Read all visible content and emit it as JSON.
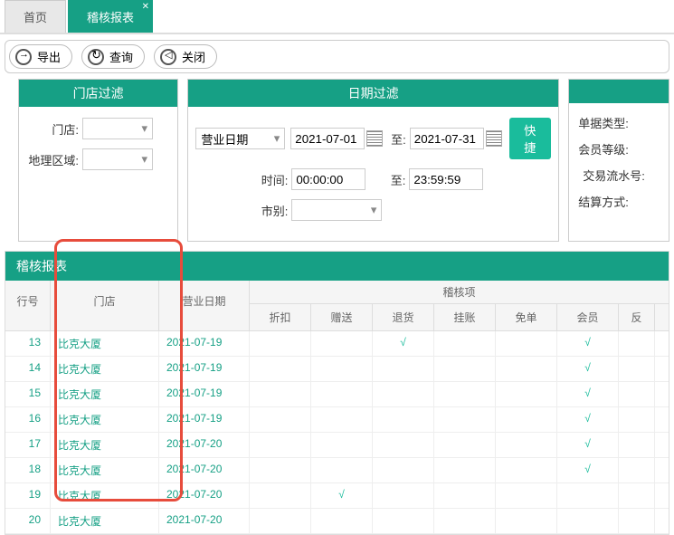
{
  "tabs": {
    "home": "首页",
    "report": "稽核报表"
  },
  "toolbar": {
    "export": "导出",
    "query": "查询",
    "close": "关闭"
  },
  "panel1": {
    "title": "门店过滤",
    "store": "门店:",
    "region": "地理区域:"
  },
  "panel2": {
    "title": "日期过滤",
    "bizdate": "营业日期",
    "to": "至:",
    "d1": "2021-07-01",
    "d2": "2021-07-31",
    "timelabel": "时间:",
    "t1": "00:00:00",
    "t2": "23:59:59",
    "shift": "市别:",
    "quick": "快捷"
  },
  "panel3": {
    "bill": "单据类型:",
    "member": "会员等级:",
    "serial": "交易流水号:",
    "settle": "结算方式:"
  },
  "report": {
    "title": "稽核报表",
    "cols": {
      "rn": "行号",
      "store": "门店",
      "date": "营业日期",
      "group": "稽核项",
      "c1": "折扣",
      "c2": "赠送",
      "c3": "退货",
      "c4": "挂账",
      "c5": "免单",
      "c6": "会员",
      "c7": "反"
    },
    "rows": [
      {
        "rn": "13",
        "store": "比克大厦",
        "date": "2021-07-19",
        "c3": "√",
        "c6": "√"
      },
      {
        "rn": "14",
        "store": "比克大厦",
        "date": "2021-07-19",
        "c6": "√"
      },
      {
        "rn": "15",
        "store": "比克大厦",
        "date": "2021-07-19",
        "c6": "√"
      },
      {
        "rn": "16",
        "store": "比克大厦",
        "date": "2021-07-19",
        "c6": "√"
      },
      {
        "rn": "17",
        "store": "比克大厦",
        "date": "2021-07-20",
        "c6": "√"
      },
      {
        "rn": "18",
        "store": "比克大厦",
        "date": "2021-07-20",
        "c6": "√"
      },
      {
        "rn": "19",
        "store": "比克大厦",
        "date": "2021-07-20",
        "c2": "√"
      },
      {
        "rn": "20",
        "store": "比克大厦",
        "date": "2021-07-20"
      }
    ]
  }
}
